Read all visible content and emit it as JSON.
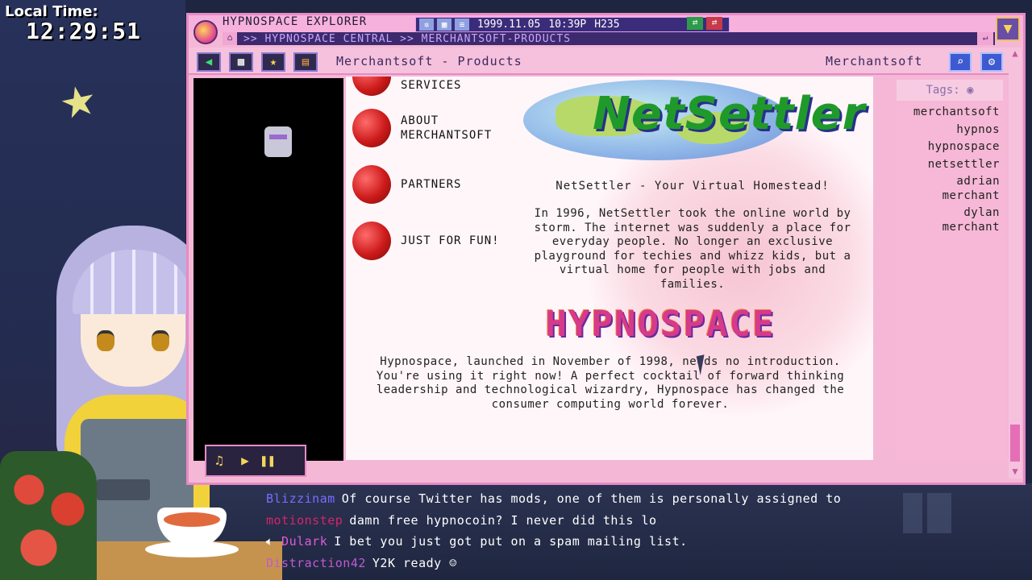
{
  "overlay": {
    "local_time_label": "Local Time:",
    "local_time_value": "12:29:51"
  },
  "window": {
    "app_title": "HYPNOSPACE EXPLORER",
    "status_date": "1999.11.05",
    "status_time": "10:39P",
    "status_coins": "H235",
    "address": ">> HYPNOSPACE CENTRAL >> MERCHANTSOFT-PRODUCTS",
    "close_icon": "close-icon",
    "accent_color": "#e78ac4"
  },
  "toolbar": {
    "page_title": "Merchantsoft - Products",
    "site_name": "Merchantsoft",
    "search_icon": "search-icon",
    "settings_icon": "settings-icon"
  },
  "nav": {
    "items": [
      {
        "label": "SERVICES"
      },
      {
        "label": "ABOUT\nMERCHANTSOFT"
      },
      {
        "label": "PARTNERS"
      },
      {
        "label": "JUST FOR FUN!"
      }
    ]
  },
  "content": {
    "netsettler_logo": "NetSettler",
    "netsettler_tagline": "NetSettler - Your Virtual Homestead!",
    "netsettler_paragraph": "In 1996, NetSettler took the online world by storm. The internet was suddenly a place for everyday people. No longer an exclusive playground for techies and whizz kids, but a virtual home for people with jobs and families.",
    "hypnospace_logo": "HYPNOSPACE",
    "hypnospace_paragraph": "Hypnospace, launched in November of 1998, needs no introduction. You're using it right now! A perfect cocktail of forward thinking leadership and technological wizardry, Hypnospace has changed the consumer computing world forever."
  },
  "tags": {
    "header": "Tags:",
    "items": [
      "merchantsoft",
      "hypnos",
      "hypnospace",
      "netsettler",
      "adrian\nmerchant",
      "dylan\nmerchant"
    ]
  },
  "chat": {
    "messages": [
      {
        "user": "Blizzinam",
        "user_color": "#7a6cff",
        "text": "Of course Twitter has mods, one of them is personally assigned to"
      },
      {
        "user": "motionstep",
        "user_color": "#d6246a",
        "text": "damn free hypnocoin? I never did this lo"
      },
      {
        "user": "Dulark",
        "user_color": "#e05ad8",
        "text": "I bet you just got put on a spam mailing list."
      },
      {
        "user": "Distraction42",
        "user_color": "#c05ad0",
        "text": "Y2K ready"
      }
    ]
  }
}
